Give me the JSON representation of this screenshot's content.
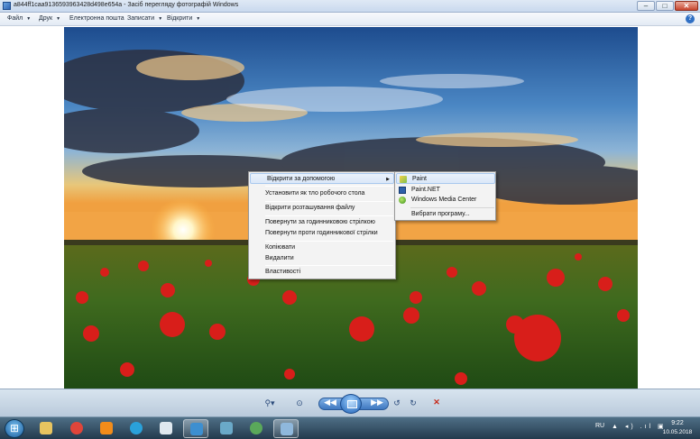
{
  "window": {
    "title": "a844ff1caa9136593963428d498e654a - Засіб перегляду фотографій Windows",
    "minimize": "–",
    "maximize": "□",
    "close": "✕"
  },
  "menu": {
    "items": [
      {
        "label": "Файл"
      },
      {
        "label": "Друк"
      },
      {
        "label": "Електронна пошта"
      },
      {
        "label": "Записати"
      },
      {
        "label": "Відкрити"
      }
    ],
    "help": "?"
  },
  "photo": {
    "subject": "sunset over a field of red poppies"
  },
  "context_menu": {
    "items": [
      {
        "label": "Відкрити за допомогою",
        "submenu": true
      },
      {
        "label": "Установити як тло робочого стола"
      },
      {
        "label": "Відкрити розташування файлу"
      },
      {
        "label": "Повернути за годинниковою стрілкою"
      },
      {
        "label": "Повернути проти годинникової стрілки"
      },
      {
        "label": "Копіювати"
      },
      {
        "label": "Видалити"
      },
      {
        "label": "Властивості"
      }
    ],
    "submenu_arrow": "▶"
  },
  "open_with_submenu": {
    "items": [
      {
        "label": "Paint",
        "icon": "paint-icon"
      },
      {
        "label": "Paint.NET",
        "icon": "paint-net-icon"
      },
      {
        "label": "Windows Media Center",
        "icon": "media-center-icon"
      },
      {
        "label": "Вибрати програму..."
      }
    ]
  },
  "controls": {
    "zoom": "⚲▾",
    "fit": "⊙",
    "prev": "◀◀",
    "next": "▶▶",
    "rotate_left": "↺",
    "rotate_right": "↻",
    "delete": "✕"
  },
  "taskbar": {
    "apps": [
      {
        "name": "file-explorer-icon",
        "color": "#e8c460"
      },
      {
        "name": "chrome-icon",
        "color": "#e0453a"
      },
      {
        "name": "sublime-icon",
        "color": "#f28c1a"
      },
      {
        "name": "telegram-icon",
        "color": "#2aa1da"
      },
      {
        "name": "notepad-icon",
        "color": "#dfe8ef"
      },
      {
        "name": "word-icon",
        "color": "#3d8fd0"
      },
      {
        "name": "app-icon",
        "color": "#6aa9c8"
      },
      {
        "name": "browser-icon",
        "color": "#5aa85a"
      },
      {
        "name": "photo-viewer-icon",
        "color": "#8fb8dc"
      }
    ],
    "language": "RU",
    "tray_icons": "▲ ◂) .ıl ▣",
    "time": "9:22",
    "date": "10.05.2018"
  }
}
